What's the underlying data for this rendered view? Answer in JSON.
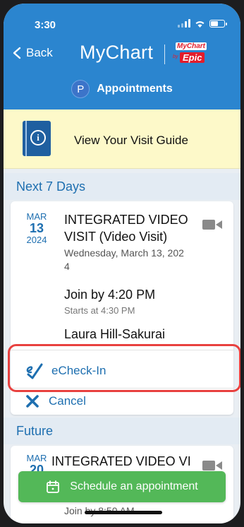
{
  "status_bar": {
    "time": "3:30"
  },
  "header": {
    "back_label": "Back",
    "brand": "MyChart",
    "epic_mychart": "MyChart",
    "epic_by": "by",
    "epic_word": "Epic",
    "avatar_initial": "P",
    "title": "Appointments"
  },
  "visit_guide": {
    "label": "View Your Visit Guide"
  },
  "sections": {
    "next": "Next 7 Days",
    "future": "Future"
  },
  "appointment_1": {
    "month": "MAR",
    "day": "13",
    "year": "2024",
    "title_line1": "INTEGRATED VIDEO",
    "title_line2": "VISIT (Video Visit)",
    "date_line1": "Wednesday, March 13, 202",
    "date_line2": "4",
    "join": "Join by 4:20 PM",
    "starts": "Starts at 4:30 PM",
    "provider": "Laura Hill-Sakurai",
    "echeckin": "eCheck-In",
    "cancel": "Cancel"
  },
  "appointment_2": {
    "month": "MAR",
    "day": "20",
    "title": "INTEGRATED VIDEO VI",
    "join": "Join by 8:50 AM"
  },
  "schedule_button": {
    "label": "Schedule an appointment"
  },
  "colors": {
    "header": "#2b85cf",
    "accent": "#1e6fb0",
    "highlight": "#e8413f",
    "schedule": "#53b858",
    "guide": "#fdf9c9"
  }
}
